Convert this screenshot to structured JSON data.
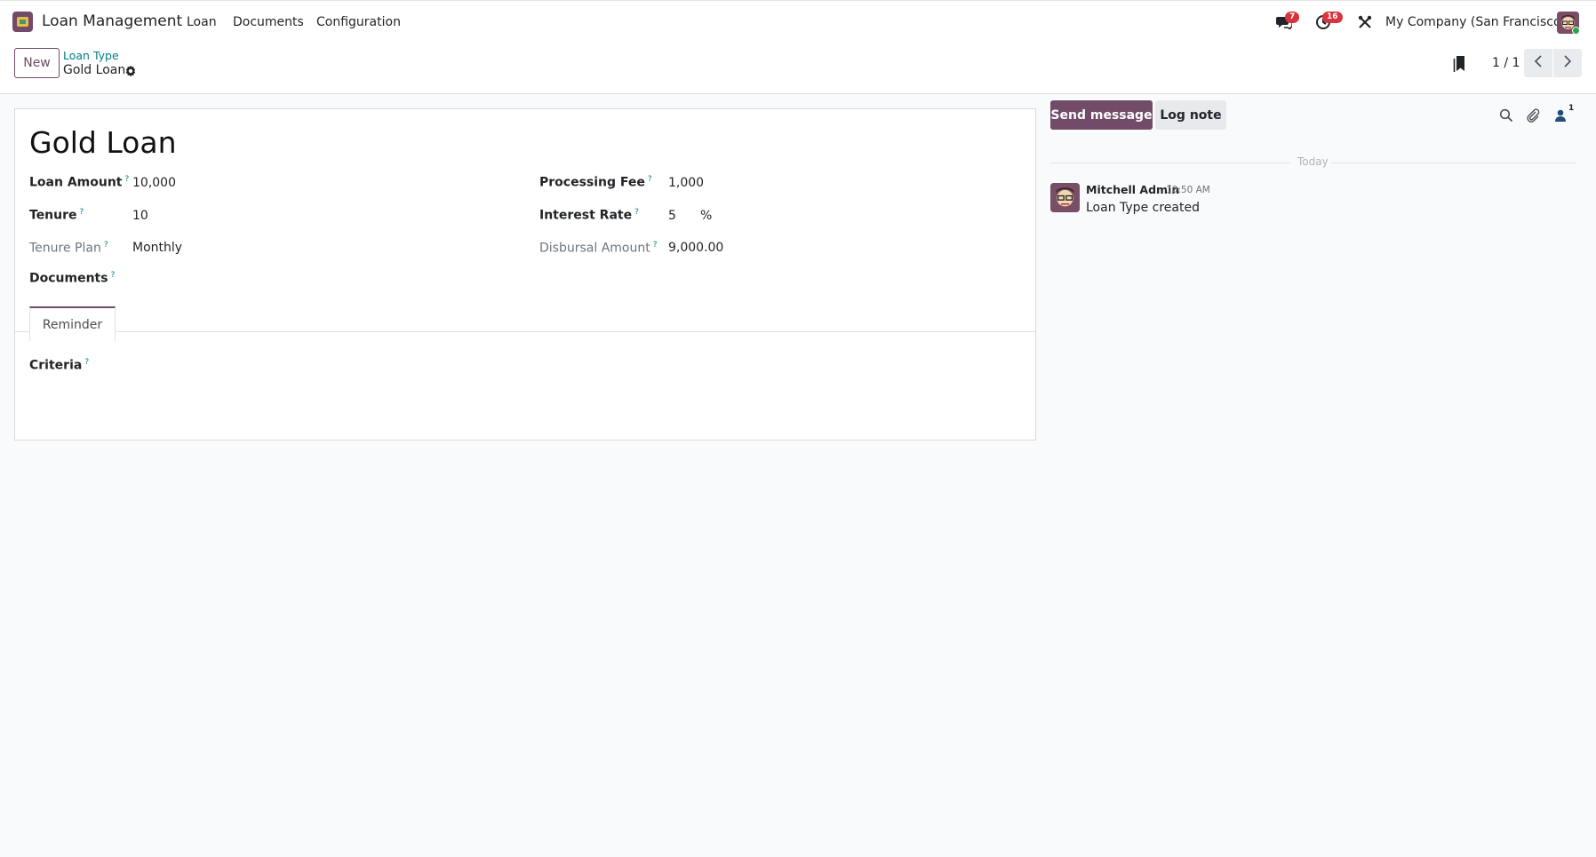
{
  "navbar": {
    "app_name": "Loan Management",
    "menu": [
      "Loan",
      "Documents",
      "Configuration"
    ],
    "messages_badge": "7",
    "activities_badge": "16",
    "company": "My Company (San Francisco)"
  },
  "control_panel": {
    "new_label": "New",
    "breadcrumb_parent": "Loan Type",
    "breadcrumb_current": "Gold Loan",
    "pager": "1 / 1"
  },
  "form": {
    "title": "Gold Loan",
    "left_fields": [
      {
        "label": "Loan Amount",
        "value": "10,000",
        "muted": false
      },
      {
        "label": "Tenure",
        "value": "10",
        "muted": false
      },
      {
        "label": "Tenure Plan",
        "value": "Monthly",
        "muted": true
      },
      {
        "label": "Documents",
        "value": "",
        "muted": false
      }
    ],
    "right_fields": [
      {
        "label": "Processing Fee",
        "value": "1,000",
        "muted": false
      },
      {
        "label": "Interest Rate",
        "value": "5",
        "suffix": "%",
        "muted": false
      },
      {
        "label": "Disbursal Amount",
        "value": "9,000.00",
        "muted": true
      }
    ],
    "help_mark": "?",
    "tab_label": "Reminder",
    "criteria_label": "Criteria"
  },
  "chatter": {
    "send_message_label": "Send message",
    "log_note_label": "Log note",
    "followers_count": "1",
    "date_separator": "Today",
    "message": {
      "author": "Mitchell Admin",
      "time": "10:50 AM",
      "body": "Loan Type created"
    }
  },
  "colors": {
    "brand": "#714B67",
    "link": "#017e84",
    "badge": "#d9333d"
  }
}
